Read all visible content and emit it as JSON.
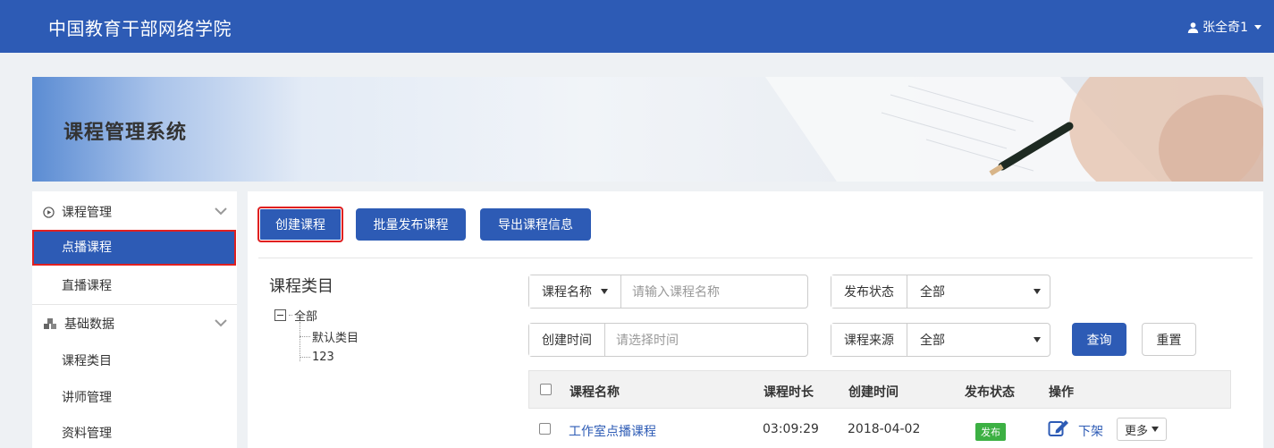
{
  "topbar": {
    "brand": "中国教育干部网络学院",
    "user": "张全奇1"
  },
  "banner": {
    "title": "课程管理系统"
  },
  "sidebar": {
    "groups": [
      {
        "label": "课程管理",
        "icon": "play-circle-icon",
        "items": [
          "点播课程",
          "直播课程"
        ]
      },
      {
        "label": "基础数据",
        "icon": "cubes-icon",
        "items": [
          "课程类目",
          "讲师管理",
          "资料管理"
        ]
      }
    ]
  },
  "toolbar": {
    "create": "创建课程",
    "batch_publish": "批量发布课程",
    "export": "导出课程信息"
  },
  "tree": {
    "title": "课程类目",
    "root": "全部",
    "children": [
      "默认类目",
      "123"
    ]
  },
  "filters": {
    "name_type": "课程名称",
    "name_placeholder": "请输入课程名称",
    "status_label": "发布状态",
    "status_value": "全部",
    "time_label": "创建时间",
    "time_placeholder": "请选择时间",
    "source_label": "课程来源",
    "source_value": "全部",
    "query": "查询",
    "reset": "重置"
  },
  "table": {
    "headers": [
      "课程名称",
      "课程时长",
      "创建时间",
      "发布状态",
      "操作"
    ],
    "rows": [
      {
        "name": "工作室点播课程",
        "duration": "03:09:29",
        "created": "2018-04-02",
        "status": "发布",
        "offline": "下架",
        "more": "更多"
      }
    ]
  },
  "colors": {
    "primary": "#2d5bb5",
    "highlight": "#e02020",
    "success": "#3cb043"
  }
}
